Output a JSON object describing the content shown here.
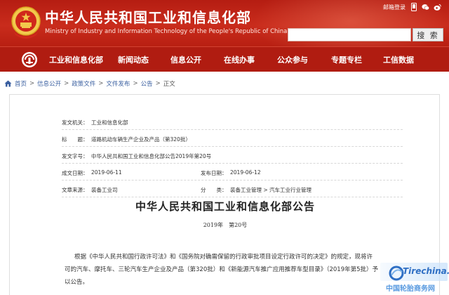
{
  "header": {
    "title": "中华人民共和国工业和信息化部",
    "subtitle": "Ministry of Industry and Information Technology of the People's Republic of China",
    "login_link": "邮箱登录",
    "search_placeholder": "",
    "search_button": "搜 索",
    "colors": {
      "header_red": "#c0251a",
      "nav_red": "#b01c11"
    }
  },
  "nav": {
    "items": [
      {
        "label": "工业和信息化部"
      },
      {
        "label": "新闻动态"
      },
      {
        "label": "信息公开"
      },
      {
        "label": "在线办事"
      },
      {
        "label": "公众参与"
      },
      {
        "label": "专题专栏"
      },
      {
        "label": "工信数据"
      }
    ]
  },
  "breadcrumb": {
    "items": [
      "首页",
      "信息公开",
      "政策文件",
      "文件发布",
      "公告"
    ],
    "separator": ">",
    "current": "正文"
  },
  "meta": {
    "issuer_label": "发文机关：",
    "issuer": "工业和信息化部",
    "subject_label": "标　　题：",
    "subject": "道路机动车辆生产企业及产品（第320批）",
    "doc_no_label": "发文字号：",
    "doc_no": "中华人民共和国工业和信息化部公告2019年第20号",
    "written_label": "成文日期：",
    "written": "2019-06-11",
    "published_label": "发布日期：",
    "published": "2019-06-12",
    "source_label": "文章来源：",
    "source": "装备工业司",
    "category_label": "分　　类：",
    "category": "装备工业管理 > 汽车工业行业管理"
  },
  "article": {
    "title": "中华人民共和国工业和信息化部公告",
    "number": "2019年　第20号",
    "body_line1": "根据《中华人民共和国行政许可法》和《国务院对确需保留的行政审批项目设定行政许可的决定》的规定，现将许",
    "body_line2": "可的汽车、摩托车、三轮汽车生产企业及产品（第320批）和《新能源汽车推广应用推荐车型目录》（2019年第5批）予",
    "body_line3": "以公告。"
  },
  "watermark": {
    "logo_text": "Tirechina.net",
    "caption": "中国轮胎商务网"
  }
}
